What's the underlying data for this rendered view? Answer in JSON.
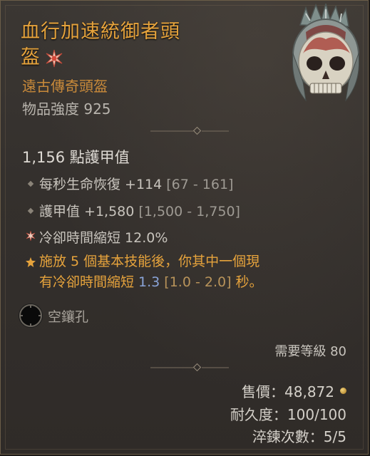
{
  "item": {
    "name_line1": "血行加速統御者頭",
    "name_line2": "盔",
    "type": "遠古傳奇頭盔",
    "item_power": "物品強度 925",
    "armor": "1,156 點護甲值"
  },
  "affixes": [
    {
      "icon": "diamond-bullet",
      "text": "每秒生命恢復 +114 ",
      "range": "[67 - 161]"
    },
    {
      "icon": "diamond-bullet",
      "text": "護甲值 +1,580 ",
      "range": "[1,500 - 1,750]"
    },
    {
      "icon": "greater-affix-star",
      "text": "冷卻時間縮短 12.0%",
      "range": ""
    }
  ],
  "legendary": {
    "icon": "legendary-star",
    "line1": "施放 5 個基本技能後，你其中一個現",
    "line2_pre": "有冷卻時間縮短 ",
    "line2_num": "1.3",
    "line2_range": " [1.0 - 2.0] ",
    "line2_post": "秒。"
  },
  "socket": {
    "icon": "empty-socket",
    "label": "空鑲孔"
  },
  "requirements": {
    "level": "需要等級 80"
  },
  "stats": {
    "sell_value": "售價：48,872",
    "durability": "耐久度：100/100",
    "tempers": "淬鍊次數：5/5"
  },
  "colors": {
    "legendary": "#e6a33c",
    "legendary_value": "#8aa4d8",
    "text": "#c8c4bd"
  }
}
